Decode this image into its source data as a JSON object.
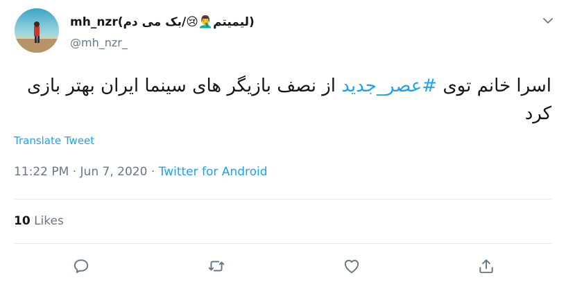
{
  "tweet": {
    "author": {
      "display_name": "mh_nzr(لیمیتم🤦‍♂️😢/بک می دم)",
      "handle": "@mh_nzr_"
    },
    "text_before_hashtag": "اسرا خانم توی ",
    "hashtag": "#عصر_جدید",
    "text_after_hashtag": " از نصف بازیگر های سینما ایران بهتر بازی کرد",
    "translate_label": "Translate Tweet",
    "time": "11:22 PM",
    "date": "Jun 7, 2020",
    "source": "Twitter for Android",
    "likes_count": "10",
    "likes_label": "Likes"
  },
  "actions": {
    "reply": "reply-icon",
    "retweet": "retweet-icon",
    "like": "heart-icon",
    "share": "share-icon"
  },
  "colors": {
    "accent": "#1da1f2",
    "muted": "#657786",
    "text": "#14171a",
    "divider": "#e6ecf0"
  }
}
